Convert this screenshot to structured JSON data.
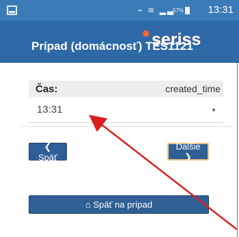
{
  "status_bar": {
    "time": "13:31",
    "battery_percent": "57%"
  },
  "header": {
    "title": "Prípad (domácnosť) TES1121",
    "watermark": "seriss"
  },
  "form": {
    "label": "Čas:",
    "field_name": "created_time",
    "value": "13:31"
  },
  "buttons": {
    "back": "❮ Späť",
    "next": "Ďalšie ❯",
    "back_to_case": "⌂ Späť na prípad"
  },
  "annotation": {
    "arrow_color": "#d91f1f"
  }
}
